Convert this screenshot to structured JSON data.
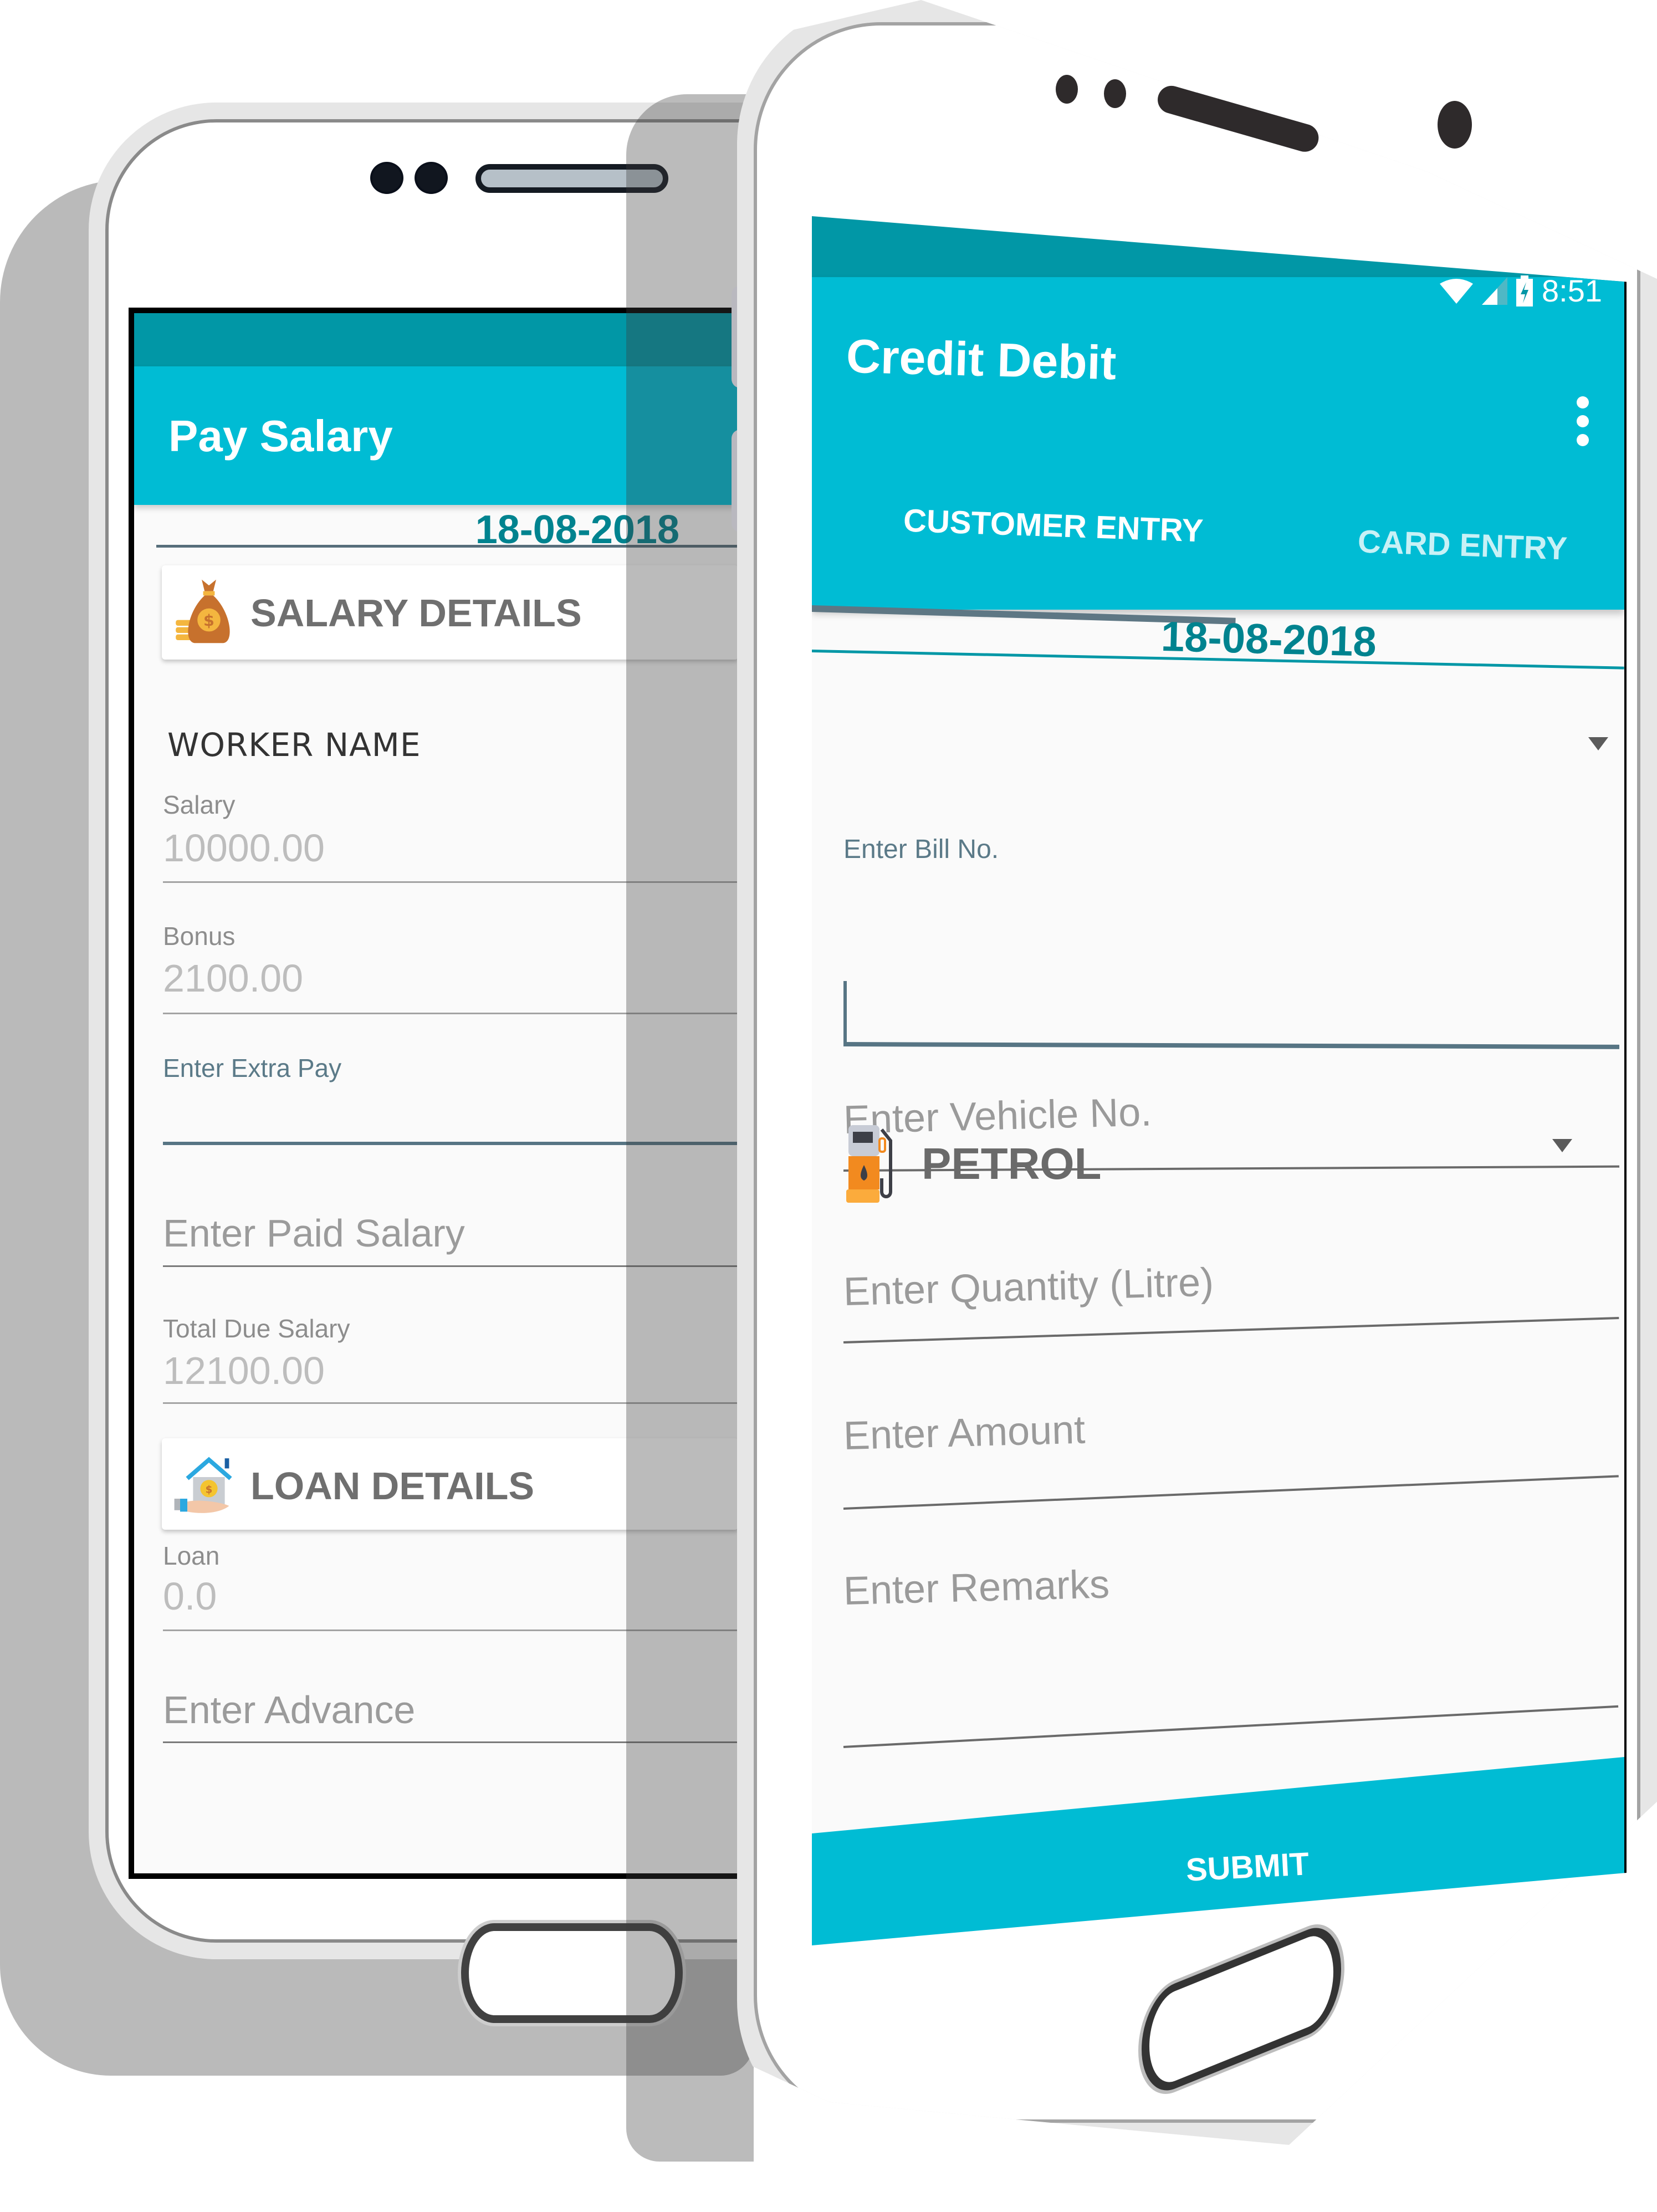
{
  "back_phone": {
    "app_title": "Pay Salary",
    "date": "18-08-2018",
    "salary_section": {
      "icon": "money-bag-icon",
      "title": "SALARY DETAILS"
    },
    "worker_name": "WORKER NAME",
    "fields": {
      "salary": {
        "label": "Salary",
        "value": "10000.00"
      },
      "bonus": {
        "label": "Bonus",
        "value": "2100.00"
      },
      "extra_pay": {
        "label": "Enter Extra Pay",
        "value": ""
      },
      "paid_salary": {
        "placeholder": "Enter Paid Salary"
      },
      "total_due": {
        "label": "Total Due Salary",
        "value": "12100.00"
      }
    },
    "loan_section": {
      "icon": "loan-house-icon",
      "title": "LOAN DETAILS"
    },
    "loan_fields": {
      "loan": {
        "label": "Loan",
        "value": "0.0"
      },
      "advance": {
        "placeholder": "Enter Advance"
      }
    }
  },
  "front_phone": {
    "status_bar": {
      "time": "8:51",
      "icons": [
        "wifi-icon",
        "signal-icon",
        "battery-charging-icon"
      ]
    },
    "app_title": "Credit Debit",
    "menu_icon": "overflow-menu-icon",
    "tabs": [
      {
        "label": "CUSTOMER ENTRY",
        "active": true
      },
      {
        "label": "CARD ENTRY",
        "active": false
      }
    ],
    "date": "18-08-2018",
    "customer_dropdown": {
      "selected": ""
    },
    "fields": {
      "bill_no": {
        "label": "Enter Bill No.",
        "value": ""
      },
      "vehicle_no": {
        "placeholder": "Enter Vehicle No."
      },
      "fuel_type": {
        "icon": "fuel-pump-icon",
        "selected": "PETROL"
      },
      "quantity": {
        "placeholder": "Enter Quantity (Litre)"
      },
      "amount": {
        "placeholder": "Enter Amount"
      },
      "remarks": {
        "placeholder": "Enter Remarks"
      }
    },
    "submit_label": "SUBMIT"
  },
  "colors": {
    "primary": "#00bcd4",
    "primary_dark": "#0197a6",
    "accent": "#00838f",
    "active_input": "#577584"
  }
}
